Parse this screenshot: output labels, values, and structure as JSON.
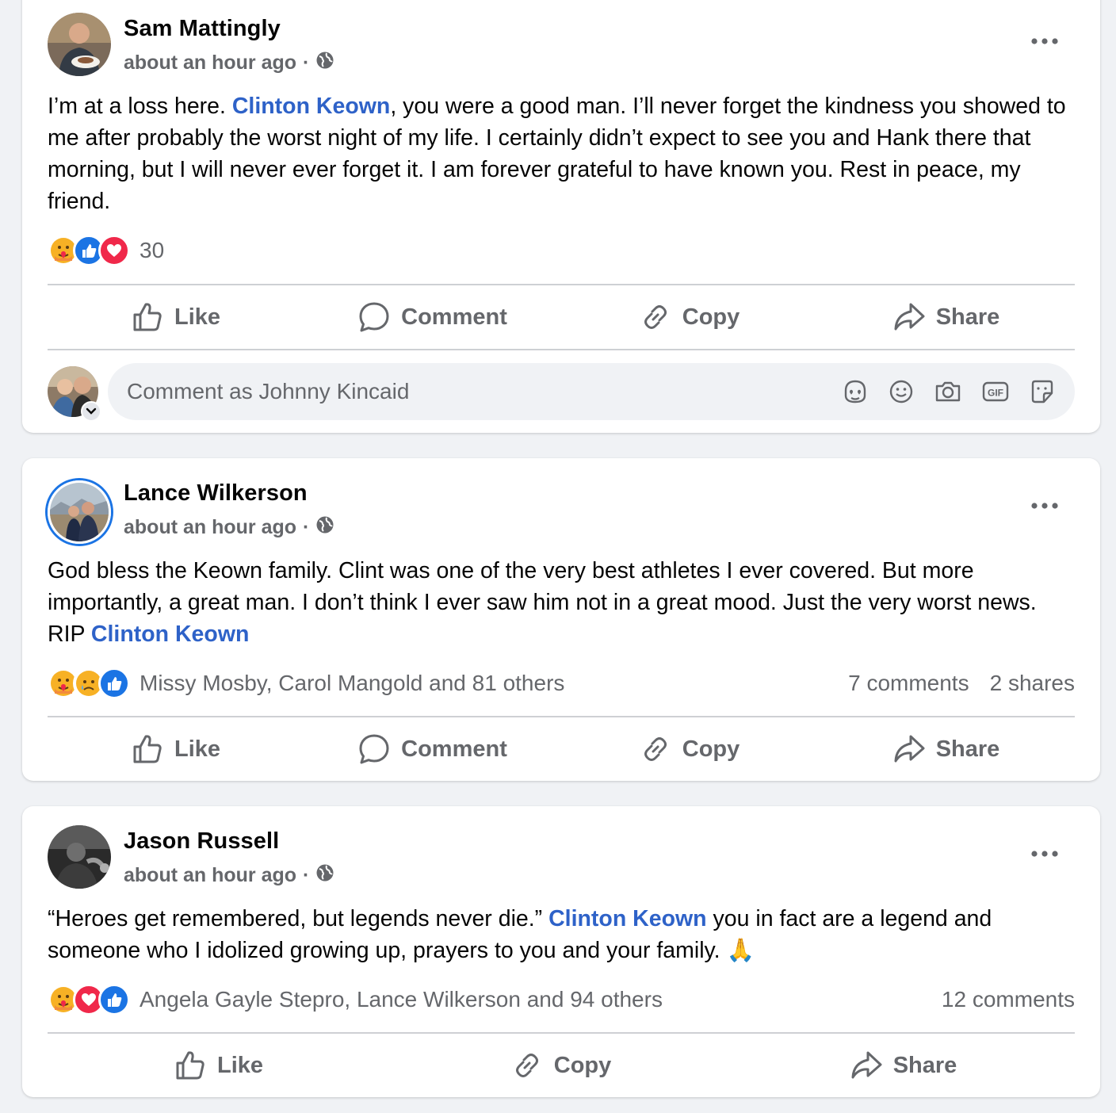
{
  "posts": [
    {
      "author": "Sam Mattingly",
      "time": "about an hour ago",
      "separator": "·",
      "privacy_icon": "globe-icon",
      "text_before": "I’m at a loss here. ",
      "mention": "Clinton Keown",
      "text_after": ", you were a good man. I’ll never forget the kindness you showed to me after probably the worst night of my life. I certainly didn’t expect to see you and Hank there that morning, but I will never ever forget it. I am forever grateful to have known you. Rest in peace, my friend.",
      "reactions": [
        "care",
        "like",
        "love"
      ],
      "reaction_summary": "30",
      "actions": {
        "like": "Like",
        "comment": "Comment",
        "copy": "Copy",
        "share": "Share"
      },
      "composer_placeholder": "Comment as Johnny Kincaid"
    },
    {
      "author": "Lance Wilkerson",
      "time": "about an hour ago",
      "separator": "·",
      "privacy_icon": "globe-icon",
      "text_before": "God bless the Keown family. Clint was one of the very best athletes I ever covered.  But more importantly, a great man. I don’t think I ever saw him not in a great mood. Just the very worst news. RIP ",
      "mention": "Clinton Keown",
      "text_after": "",
      "reactions": [
        "care",
        "sad",
        "like"
      ],
      "reaction_summary": "Missy Mosby, Carol Mangold and 81 others",
      "comments_count": "7 comments",
      "shares_count": "2 shares",
      "actions": {
        "like": "Like",
        "comment": "Comment",
        "copy": "Copy",
        "share": "Share"
      }
    },
    {
      "author": "Jason Russell",
      "time": "about an hour ago",
      "separator": "·",
      "privacy_icon": "globe-icon",
      "text_before": "“Heroes get remembered, but legends never die.” ",
      "mention": "Clinton Keown",
      "text_after": " you in fact are a legend and someone who I idolized growing up, prayers to you and your family. 🙏",
      "reactions": [
        "care",
        "love",
        "like"
      ],
      "reaction_summary": "Angela Gayle Stepro, Lance Wilkerson and 94 others",
      "comments_count": "12 comments",
      "actions": {
        "like": "Like",
        "copy": "Copy",
        "share": "Share"
      }
    }
  ],
  "colors": {
    "mention": "#2e62c8",
    "secondary_text": "#65676b",
    "like_blue": "#1b74e4",
    "love_red": "#f0284a",
    "background": "#f0f2f5"
  }
}
